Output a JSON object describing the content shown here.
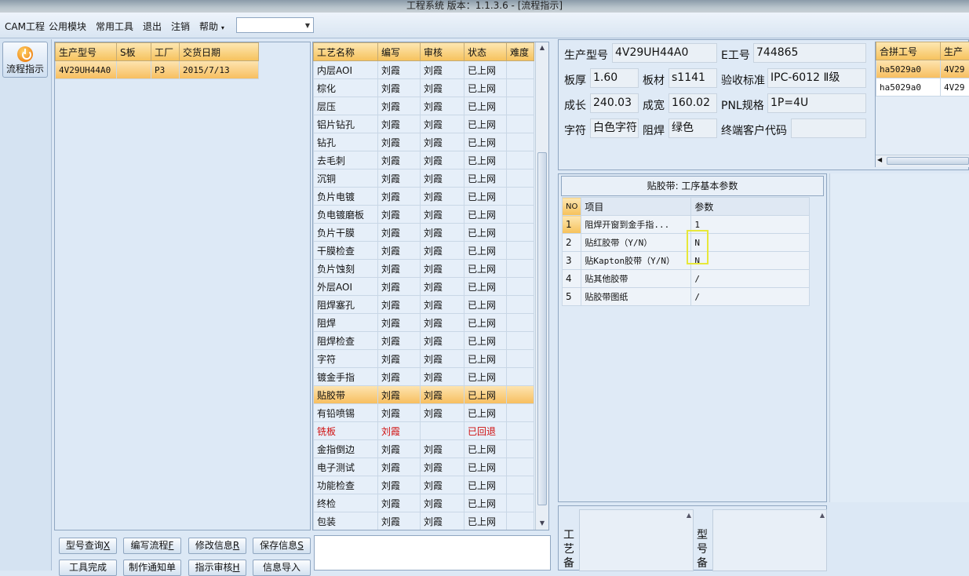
{
  "title": "工程系统   版本：1.1.3.6 - [流程指示]",
  "menu": {
    "items": [
      "CAM工程",
      "公用模块",
      "常用工具",
      "退出",
      "注销",
      "帮助"
    ],
    "help_arrow": "▾"
  },
  "sidebar": {
    "flow_label": "流程指示"
  },
  "orders": {
    "headers": [
      "生产型号",
      "S板",
      "工厂",
      "交货日期"
    ],
    "rows": [
      {
        "model": "4V29UH44A0",
        "s": "",
        "factory": "P3",
        "date": "2015/7/13"
      }
    ]
  },
  "process": {
    "headers": [
      "工艺名称",
      "编写",
      "审核",
      "状态",
      "难度"
    ],
    "rows": [
      {
        "name": "内层AOI",
        "writer": "刘霞",
        "reviewer": "刘霞",
        "status": "已上网"
      },
      {
        "name": "棕化",
        "writer": "刘霞",
        "reviewer": "刘霞",
        "status": "已上网"
      },
      {
        "name": "层压",
        "writer": "刘霞",
        "reviewer": "刘霞",
        "status": "已上网"
      },
      {
        "name": "铝片钻孔",
        "writer": "刘霞",
        "reviewer": "刘霞",
        "status": "已上网"
      },
      {
        "name": "钻孔",
        "writer": "刘霞",
        "reviewer": "刘霞",
        "status": "已上网"
      },
      {
        "name": "去毛刺",
        "writer": "刘霞",
        "reviewer": "刘霞",
        "status": "已上网"
      },
      {
        "name": "沉铜",
        "writer": "刘霞",
        "reviewer": "刘霞",
        "status": "已上网"
      },
      {
        "name": "负片电镀",
        "writer": "刘霞",
        "reviewer": "刘霞",
        "status": "已上网"
      },
      {
        "name": "负电镀磨板",
        "writer": "刘霞",
        "reviewer": "刘霞",
        "status": "已上网"
      },
      {
        "name": "负片干膜",
        "writer": "刘霞",
        "reviewer": "刘霞",
        "status": "已上网"
      },
      {
        "name": "干膜检查",
        "writer": "刘霞",
        "reviewer": "刘霞",
        "status": "已上网"
      },
      {
        "name": "负片蚀刻",
        "writer": "刘霞",
        "reviewer": "刘霞",
        "status": "已上网"
      },
      {
        "name": "外层AOI",
        "writer": "刘霞",
        "reviewer": "刘霞",
        "status": "已上网"
      },
      {
        "name": "阻焊塞孔",
        "writer": "刘霞",
        "reviewer": "刘霞",
        "status": "已上网"
      },
      {
        "name": "阻焊",
        "writer": "刘霞",
        "reviewer": "刘霞",
        "status": "已上网"
      },
      {
        "name": "阻焊检查",
        "writer": "刘霞",
        "reviewer": "刘霞",
        "status": "已上网"
      },
      {
        "name": "字符",
        "writer": "刘霞",
        "reviewer": "刘霞",
        "status": "已上网"
      },
      {
        "name": "镀金手指",
        "writer": "刘霞",
        "reviewer": "刘霞",
        "status": "已上网"
      },
      {
        "name": "贴胶带",
        "writer": "刘霞",
        "reviewer": "刘霞",
        "status": "已上网",
        "selected": true
      },
      {
        "name": "有铅喷锡",
        "writer": "刘霞",
        "reviewer": "刘霞",
        "status": "已上网"
      },
      {
        "name": "铣板",
        "writer": "刘霞",
        "reviewer": "",
        "status": "已回退",
        "returned": true
      },
      {
        "name": "金指倒边",
        "writer": "刘霞",
        "reviewer": "刘霞",
        "status": "已上网"
      },
      {
        "name": "电子测试",
        "writer": "刘霞",
        "reviewer": "刘霞",
        "status": "已上网"
      },
      {
        "name": "功能检查",
        "writer": "刘霞",
        "reviewer": "刘霞",
        "status": "已上网"
      },
      {
        "name": "终检",
        "writer": "刘霞",
        "reviewer": "刘霞",
        "status": "已上网"
      },
      {
        "name": "包装",
        "writer": "刘霞",
        "reviewer": "刘霞",
        "status": "已上网"
      }
    ]
  },
  "info": {
    "model_label": "生产型号",
    "model": "4V29UH44A0",
    "e_label": "E工号",
    "e_no": "744865",
    "thick_label": "板厚",
    "thick": "1.60",
    "mat_label": "板材",
    "mat": "s1141",
    "std_label": "验收标准",
    "std": "IPC-6012 Ⅱ级",
    "len_label": "成长",
    "len": "240.03",
    "wid_label": "成宽",
    "wid": "160.02",
    "pnl_label": "PNL规格",
    "pnl": "1P=4U",
    "char_label": "字符",
    "char": "白色字符",
    "mask_label": "阻焊",
    "mask": "绿色",
    "cust_label": "终端客户代码",
    "cust": ""
  },
  "merge": {
    "headers": [
      "合拼工号",
      "生产"
    ],
    "rows": [
      [
        "ha5029a0",
        "4V29"
      ],
      [
        "ha5029a0",
        "4V29"
      ]
    ]
  },
  "params": {
    "title": "贴胶带: 工序基本参数",
    "headers": [
      "NO",
      "项目",
      "参数"
    ],
    "rows": [
      {
        "no": "1",
        "item": "阻焊开窗到金手指...",
        "value": "1"
      },
      {
        "no": "2",
        "item": "贴红胶带（Y/N）",
        "value": "N"
      },
      {
        "no": "3",
        "item": "贴Kapton胶带（Y/N）",
        "value": "N"
      },
      {
        "no": "4",
        "item": "贴其他胶带",
        "value": "/"
      },
      {
        "no": "5",
        "item": "贴胶带图纸",
        "value": "/"
      }
    ]
  },
  "buttons": {
    "query": "型号查询",
    "query_key": "X",
    "write": "编写流程",
    "write_key": "F",
    "modify": "修改信息",
    "modify_key": "R",
    "save": "保存信息",
    "save_key": "S",
    "tool": "工具完成",
    "notice": "制作通知单",
    "review": "指示审核",
    "review_key": "H",
    "import": "信息导入"
  },
  "notes": {
    "craft_label": "工艺备",
    "model_label": "型号备"
  }
}
